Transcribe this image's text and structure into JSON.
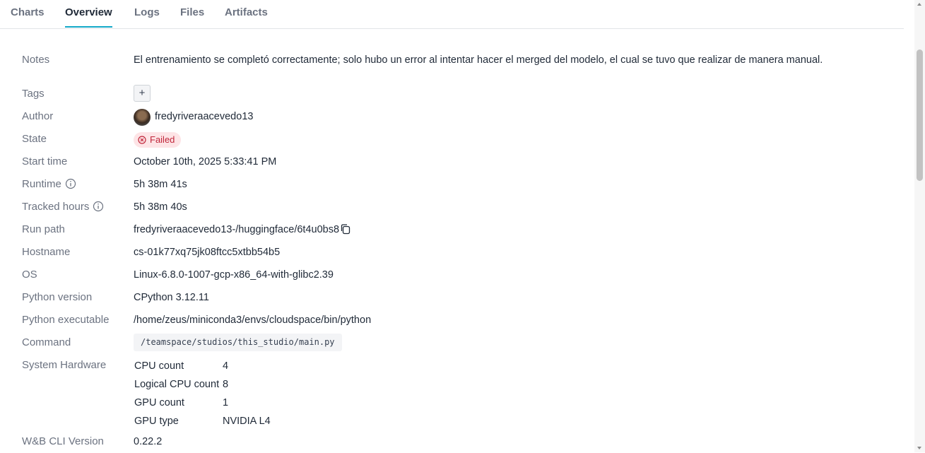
{
  "tabs": [
    {
      "label": "Charts"
    },
    {
      "label": "Overview"
    },
    {
      "label": "Logs"
    },
    {
      "label": "Files"
    },
    {
      "label": "Artifacts"
    }
  ],
  "active_tab": "Overview",
  "overview": {
    "notes_label": "Notes",
    "notes_value": "El entrenamiento se completó correctamente; solo hubo un error al intentar hacer el merged del modelo, el cual se tuvo que realizar de manera manual.",
    "tags_label": "Tags",
    "tags_add": "+",
    "author_label": "Author",
    "author_value": "fredyriveraacevedo13",
    "state_label": "State",
    "state_value": "Failed",
    "start_time_label": "Start time",
    "start_time_value": "October 10th, 2025 5:33:41 PM",
    "runtime_label": "Runtime",
    "runtime_value": "5h 38m 41s",
    "tracked_hours_label": "Tracked hours",
    "tracked_hours_value": "5h 38m 40s",
    "run_path_label": "Run path",
    "run_path_value": "fredyriveraacevedo13-/huggingface/6t4u0bs8",
    "hostname_label": "Hostname",
    "hostname_value": "cs-01k77xq75jk08ftcc5xtbb54b5",
    "os_label": "OS",
    "os_value": "Linux-6.8.0-1007-gcp-x86_64-with-glibc2.39",
    "python_version_label": "Python version",
    "python_version_value": "CPython 3.12.11",
    "python_executable_label": "Python executable",
    "python_executable_value": "/home/zeus/miniconda3/envs/cloudspace/bin/python",
    "command_label": "Command",
    "command_value": "/teamspace/studios/this_studio/main.py",
    "system_hardware_label": "System Hardware",
    "hardware": [
      {
        "key": "CPU count",
        "value": "4"
      },
      {
        "key": "Logical CPU count",
        "value": "8"
      },
      {
        "key": "GPU count",
        "value": "1"
      },
      {
        "key": "GPU type",
        "value": "NVIDIA L4"
      }
    ],
    "wandb_cli_label": "W&B CLI Version",
    "wandb_cli_value": "0.22.2"
  },
  "colors": {
    "accent": "#13a8c8",
    "failed_bg": "#fde4e6",
    "failed_text": "#c0263a",
    "label_gray": "#6b7280"
  },
  "icons": {
    "info": "info-circle-icon",
    "copy": "copy-icon",
    "failed": "x-circle-icon"
  }
}
